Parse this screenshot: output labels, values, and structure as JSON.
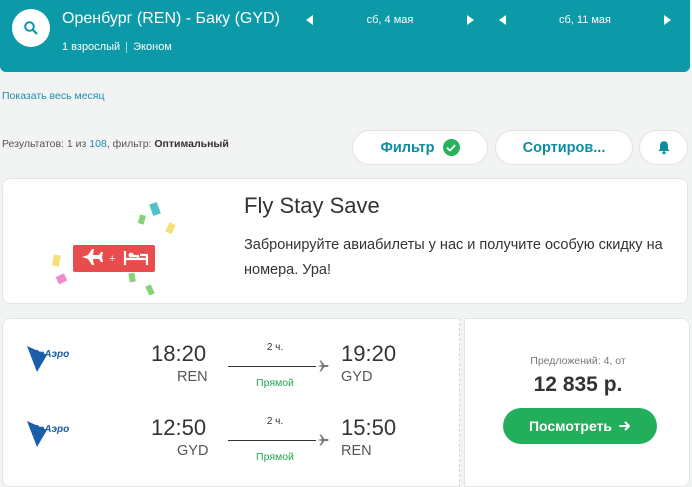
{
  "header": {
    "route": "Оренбург (REN) - Баку (GYD)",
    "passengers": "1 взрослый",
    "cabin": "Эконом",
    "depart_date": "сб, 4 мая",
    "return_date": "сб, 11 мая",
    "accent_color": "#0c9aa8"
  },
  "month_link": "Показать весь месяц",
  "results": {
    "prefix": "Результатов: 1 из ",
    "count": "108",
    "filter_label": ", фильтр: ",
    "filter_value": "Оптимальный"
  },
  "toolbar": {
    "filter_label": "Фильтр",
    "sort_label": "Сортиров..."
  },
  "promo": {
    "title": "Fly Stay Save",
    "text": "Забронируйте авиабилеты у нас и получите особую скидку на номера. Ура!"
  },
  "ticket": {
    "airline_logo_text": "ИрАэро",
    "outbound": {
      "dep_time": "18:20",
      "dep_code": "REN",
      "duration": "2 ч.",
      "type": "Прямой",
      "arr_time": "19:20",
      "arr_code": "GYD"
    },
    "inbound": {
      "dep_time": "12:50",
      "dep_code": "GYD",
      "duration": "2 ч.",
      "type": "Прямой",
      "arr_time": "15:50",
      "arr_code": "REN"
    },
    "offers_text": "Предложений: 4, от",
    "price": "12 835 р.",
    "view_button": "Посмотреть"
  },
  "icons": {
    "search": "search-icon",
    "prev": "triangle-left-icon",
    "next": "triangle-right-icon",
    "check": "check-icon",
    "bell": "bell-icon",
    "plane": "plane-icon",
    "arrow": "arrow-right-icon"
  }
}
